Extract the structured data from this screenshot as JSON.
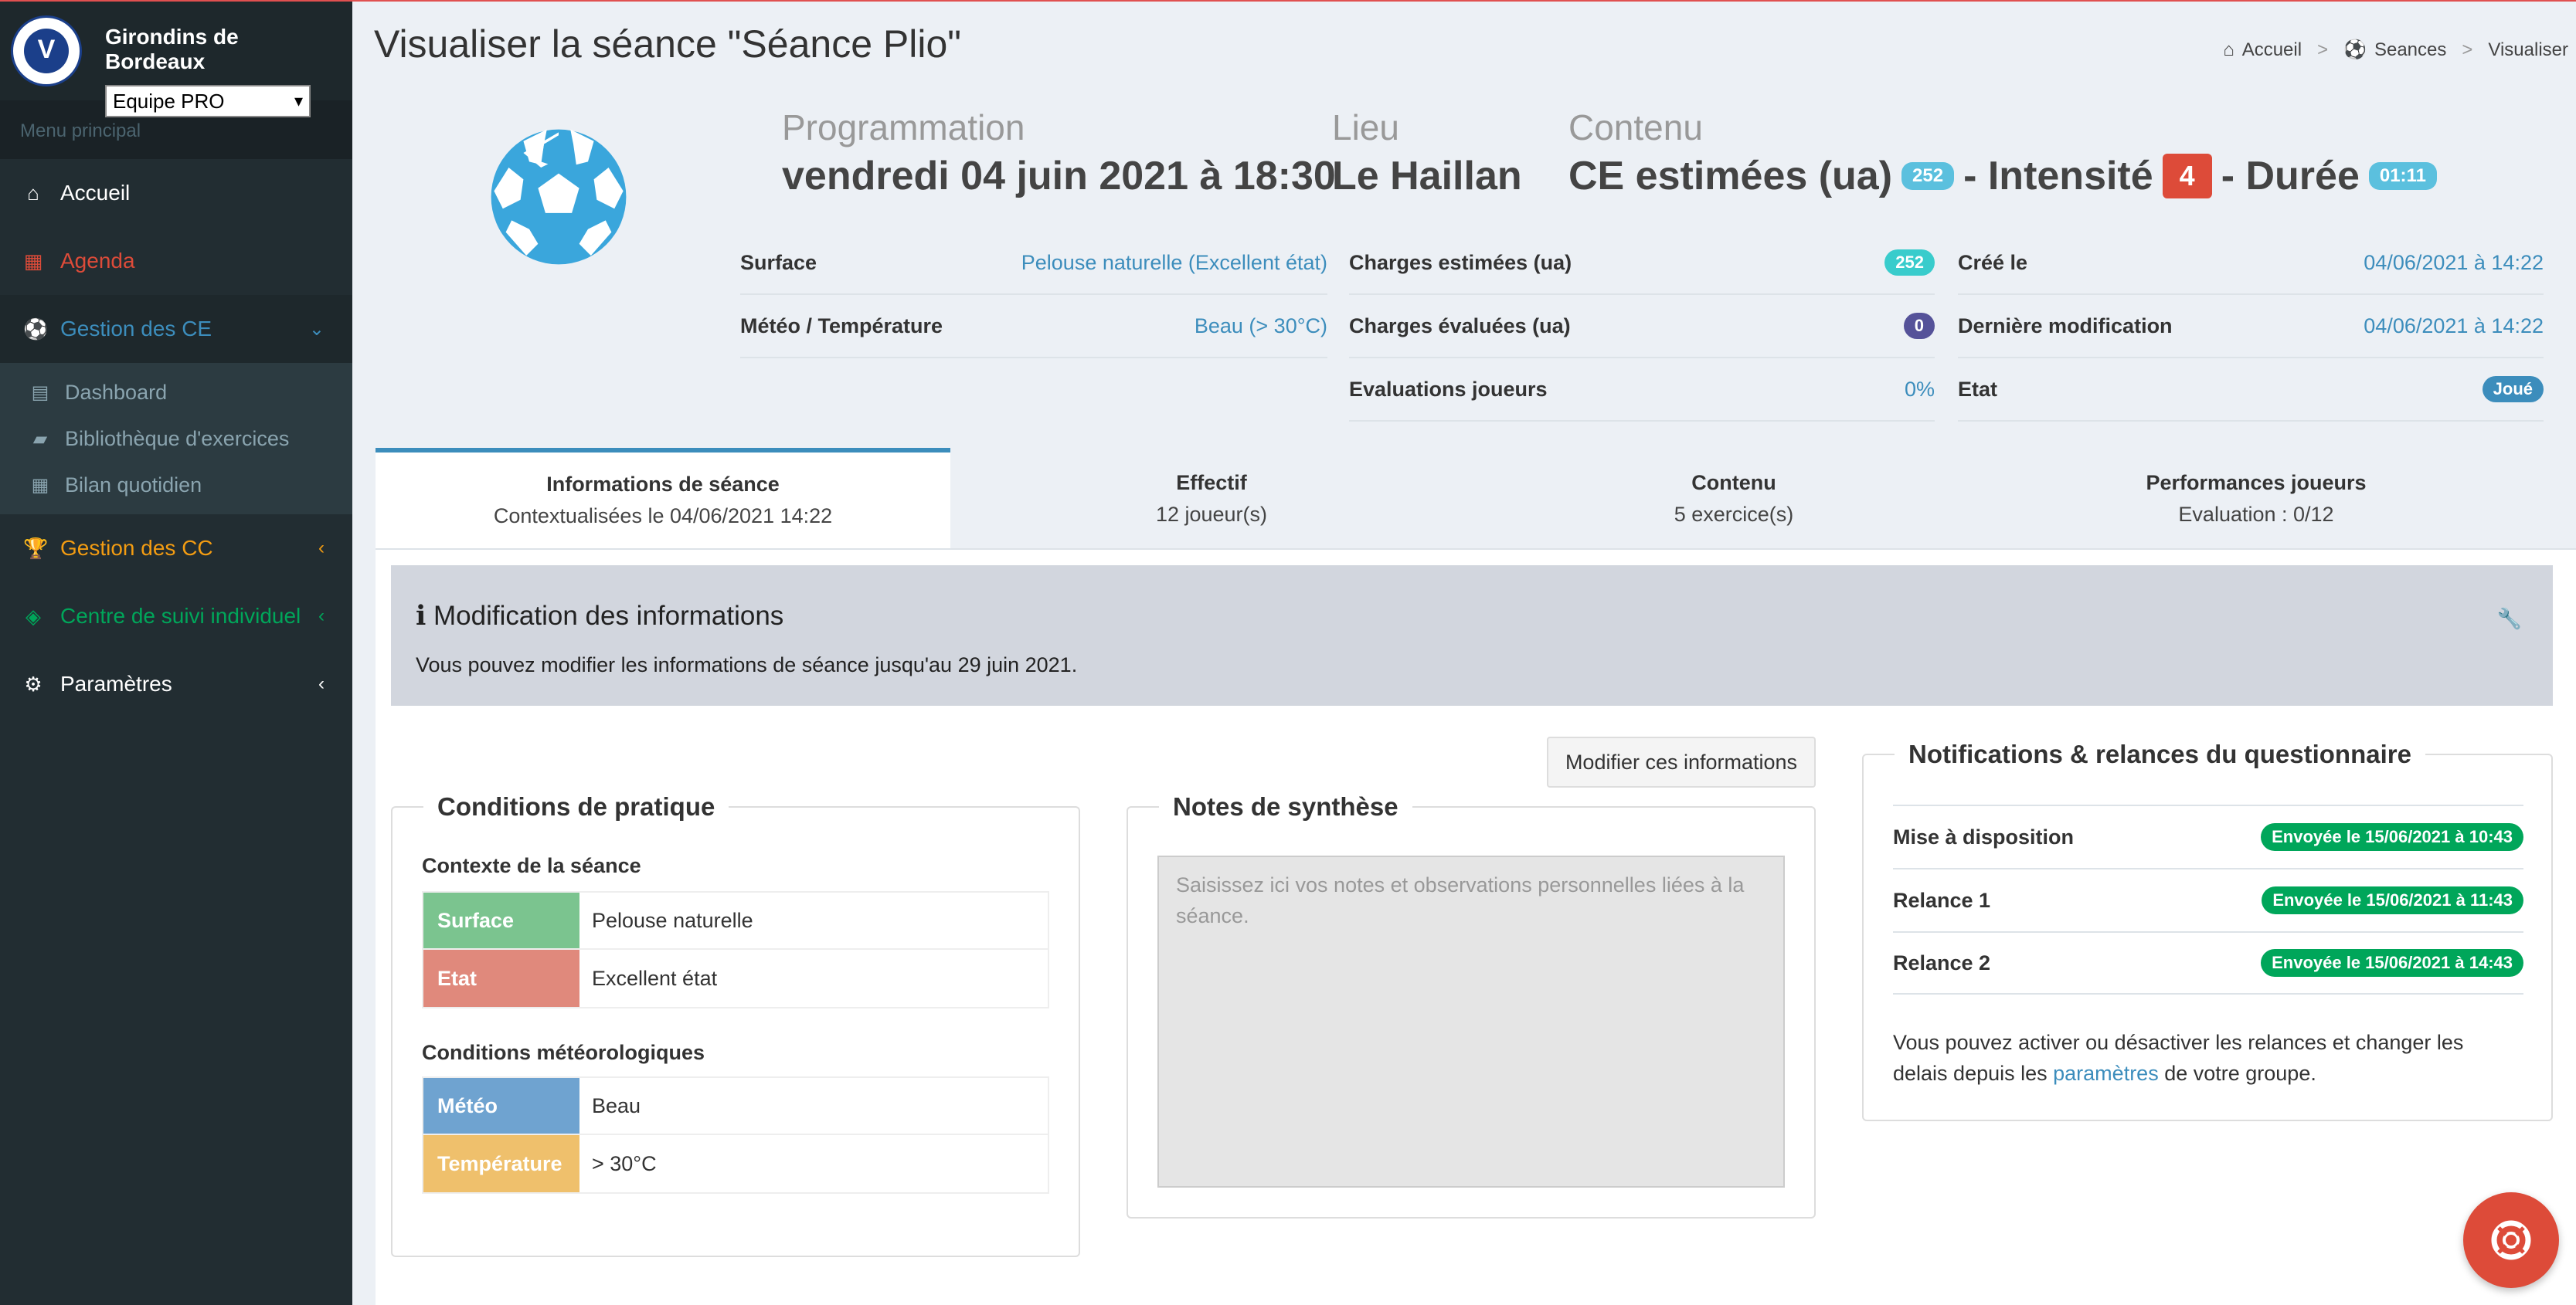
{
  "brand": {
    "name": "Girondins de Bordeaux",
    "team_selected": "Equipe PRO"
  },
  "sidebar": {
    "menu_header": "Menu principal",
    "items": {
      "accueil": "Accueil",
      "agenda": "Agenda",
      "gestion_ce": "Gestion des CE",
      "dashboard": "Dashboard",
      "bibliotheque": "Bibliothèque d'exercices",
      "bilan": "Bilan quotidien",
      "gestion_cc": "Gestion des CC",
      "suivi": "Centre de suivi individuel",
      "parametres": "Paramètres"
    }
  },
  "page": {
    "title": "Visualiser la séance \"Séance Plio\"",
    "breadcrumb": [
      "Accueil",
      "Seances",
      "Visualiser"
    ]
  },
  "header": {
    "programmation_label": "Programmation",
    "programmation_value": "vendredi 04 juin 2021 à 18:30",
    "lieu_label": "Lieu",
    "lieu_value": "Le Haillan",
    "contenu_label": "Contenu",
    "ce_label": "CE estimées (ua)",
    "ce_badge": "252",
    "intensite_label": "- Intensité",
    "intensite_value": "4",
    "duree_label": "- Durée",
    "duree_badge": "01:11"
  },
  "info": {
    "surface_k": "Surface",
    "surface_v": "Pelouse naturelle (Excellent état)",
    "meteo_k": "Météo / Température",
    "meteo_v": "Beau (> 30°C)",
    "charges_est_k": "Charges estimées (ua)",
    "charges_est_v": "252",
    "charges_eval_k": "Charges évaluées (ua)",
    "charges_eval_v": "0",
    "eval_joueurs_k": "Evaluations joueurs",
    "eval_joueurs_v": "0%",
    "cree_k": "Créé le",
    "cree_v": "04/06/2021 à 14:22",
    "modif_k": "Dernière modification",
    "modif_v": "04/06/2021 à 14:22",
    "etat_k": "Etat",
    "etat_v": "Joué"
  },
  "tabs": [
    {
      "title": "Informations de séance",
      "sub": "Contextualisées le 04/06/2021 14:22"
    },
    {
      "title": "Effectif",
      "sub": "12 joueur(s)"
    },
    {
      "title": "Contenu",
      "sub": "5 exercice(s)"
    },
    {
      "title": "Performances joueurs",
      "sub": "Evaluation : 0/12"
    }
  ],
  "callout": {
    "title": "Modification des informations",
    "text": "Vous pouvez modifier les informations de séance jusqu'au 29 juin 2021."
  },
  "modify_button": "Modifier ces informations",
  "conditions": {
    "legend": "Conditions de pratique",
    "contexte_title": "Contexte de la séance",
    "surface_k": "Surface",
    "surface_v": "Pelouse naturelle",
    "etat_k": "Etat",
    "etat_v": "Excellent état",
    "meteo_title": "Conditions météorologiques",
    "meteo_k": "Météo",
    "meteo_v": "Beau",
    "temp_k": "Température",
    "temp_v": "> 30°C"
  },
  "notes": {
    "legend": "Notes de synthèse",
    "placeholder": "Saisissez ici vos notes et observations personnelles liées à la séance."
  },
  "notifications": {
    "legend": "Notifications & relances du questionnaire",
    "rows": [
      {
        "label": "Mise à disposition",
        "status": "Envoyée le 15/06/2021 à 10:43"
      },
      {
        "label": "Relance 1",
        "status": "Envoyée le 15/06/2021 à 11:43"
      },
      {
        "label": "Relance 2",
        "status": "Envoyée le 15/06/2021 à 14:43"
      }
    ],
    "text_before": "Vous pouvez activer ou désactiver les relances et changer les delais depuis les ",
    "link": "paramètres",
    "text_after": " de votre groupe."
  },
  "colors": {
    "sidebar_bg": "#222d32",
    "accent_blue": "#3c8dbc",
    "surface_green": "#7bc48f",
    "etat_red": "#e0897c",
    "meteo_blue": "#6fa3d0",
    "temp_orange": "#efc06c"
  }
}
